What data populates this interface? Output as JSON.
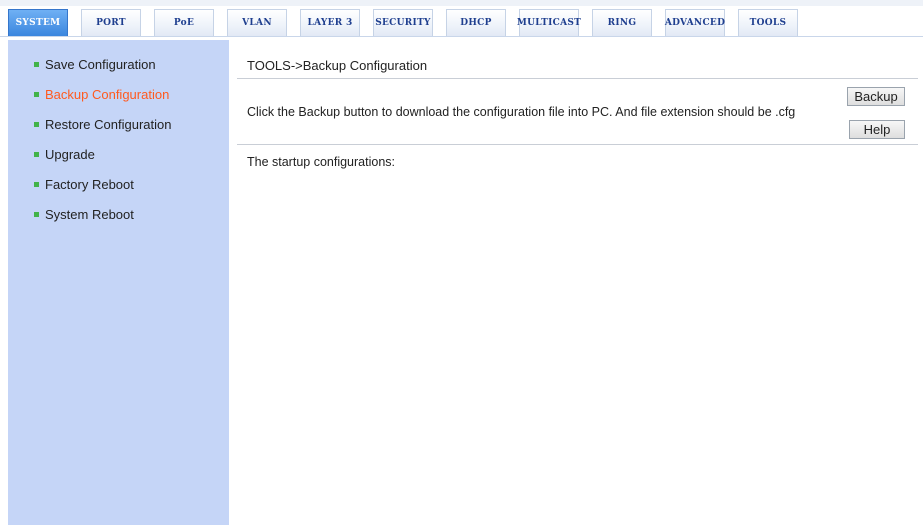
{
  "nav": {
    "tabs": [
      {
        "label": "SYSTEM",
        "active": true
      },
      {
        "label": "PORT",
        "active": false
      },
      {
        "label": "PoE",
        "active": false
      },
      {
        "label": "VLAN",
        "active": false
      },
      {
        "label": "LAYER 3",
        "active": false
      },
      {
        "label": "SECURITY",
        "active": false
      },
      {
        "label": "DHCP",
        "active": false
      },
      {
        "label": "MULTICAST",
        "active": false
      },
      {
        "label": "RING",
        "active": false
      },
      {
        "label": "ADVANCED",
        "active": false
      },
      {
        "label": "TOOLS",
        "active": false
      }
    ]
  },
  "sidebar": {
    "items": [
      {
        "label": "Save Configuration",
        "active": false
      },
      {
        "label": "Backup Configuration",
        "active": true
      },
      {
        "label": "Restore Configuration",
        "active": false
      },
      {
        "label": "Upgrade",
        "active": false
      },
      {
        "label": "Factory Reboot",
        "active": false
      },
      {
        "label": "System Reboot",
        "active": false
      }
    ]
  },
  "main": {
    "breadcrumb": "TOOLS->Backup Configuration",
    "description": "Click the Backup button to download the configuration file into PC. And file extension should be .cfg",
    "backup_label": "Backup",
    "help_label": "Help",
    "startup_label": "The startup configurations:"
  },
  "colors": {
    "sidebar_bg": "#c5d5f7",
    "active_tab": "#3b86de",
    "active_item": "#ff5a1f",
    "bullet": "#42b349"
  }
}
